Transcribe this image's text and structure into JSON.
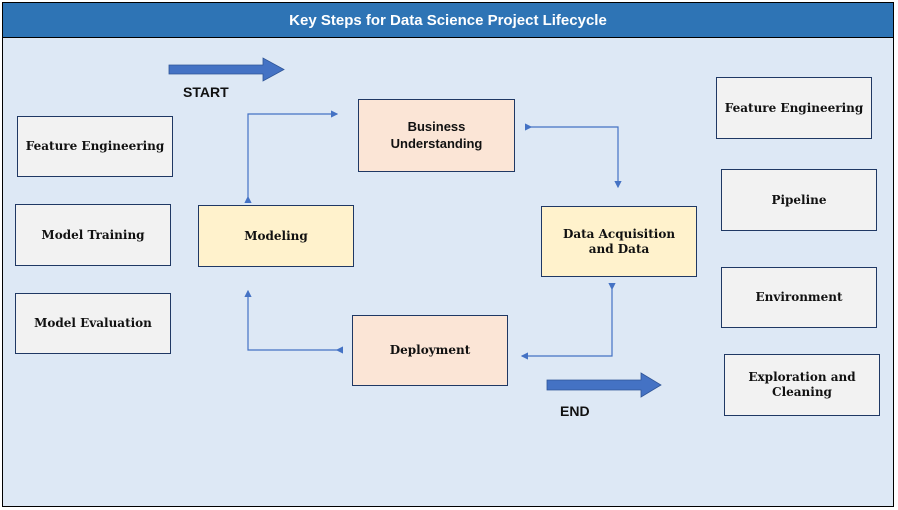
{
  "title": "Key Steps for Data Science Project Lifecycle",
  "colors": {
    "header": "#2e74b5",
    "background": "#dde8f5",
    "arrow": "#4472c4",
    "connector": "#4472c4",
    "box_grey": "#f2f2f2",
    "box_peach": "#fbe5d6",
    "box_yellow": "#fff2cc",
    "box_border": "#1f3864"
  },
  "markers": {
    "start": "START",
    "end": "END"
  },
  "left_column": [
    "Feature Engineering",
    "Model Training",
    "Model Evaluation"
  ],
  "cycle": {
    "business_understanding": "Business\nUnderstanding",
    "data_acquisition": "Data Acquisition\nand Data",
    "deployment": "Deployment",
    "modeling": "Modeling"
  },
  "right_column": [
    "Feature Engineering",
    "Pipeline",
    "Environment",
    "Exploration and\nCleaning"
  ],
  "flow": [
    {
      "from": "Modeling",
      "to": "Business Understanding"
    },
    {
      "from": "Business Understanding",
      "to": "Data Acquisition and Data"
    },
    {
      "from": "Data Acquisition and Data",
      "to": "Deployment"
    },
    {
      "from": "Deployment",
      "to": "Modeling"
    }
  ]
}
